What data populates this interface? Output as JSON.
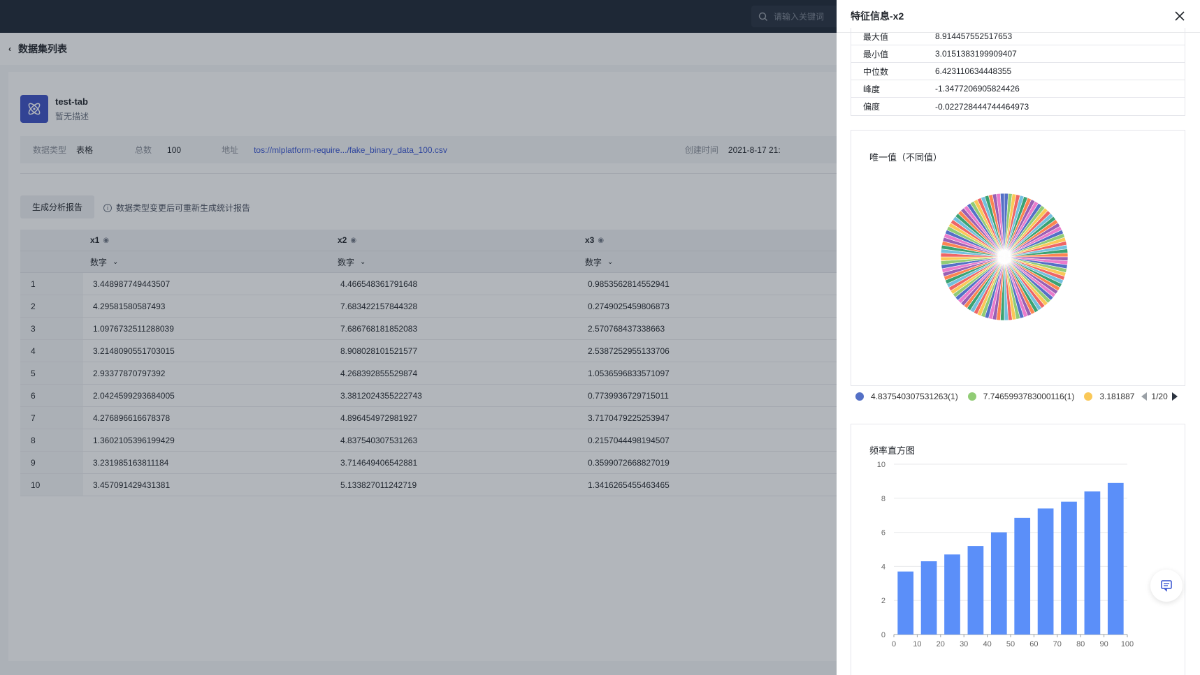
{
  "topbar": {
    "search_placeholder": "请输入关键词"
  },
  "breadcrumb": {
    "label": "数据集列表"
  },
  "dataset": {
    "name": "test-tab",
    "description": "暂无描述",
    "meta": {
      "type_label": "数据类型",
      "type_value": "表格",
      "count_label": "总数",
      "count_value": "100",
      "addr_label": "地址",
      "addr_value": "tos://mlplatform-require.../fake_binary_data_100.csv",
      "created_label": "创建时间",
      "created_value": "2021-8-17 21:"
    }
  },
  "actions": {
    "generate_report": "生成分析报告",
    "tip": "数据类型变更后可重新生成统计报告"
  },
  "table": {
    "columns": [
      {
        "name": "x1",
        "type": "数字"
      },
      {
        "name": "x2",
        "type": "数字"
      },
      {
        "name": "x3",
        "type": "数字"
      }
    ],
    "rows": [
      {
        "idx": "1",
        "c1": "3.448987749443507",
        "c2": "4.466548361791648",
        "c3": "0.9853562814552941"
      },
      {
        "idx": "2",
        "c1": "4.29581580587493",
        "c2": "7.683422157844328",
        "c3": "0.2749025459806873"
      },
      {
        "idx": "3",
        "c1": "1.0976732511288039",
        "c2": "7.686768181852083",
        "c3": "2.570768437338663"
      },
      {
        "idx": "4",
        "c1": "3.2148090551703015",
        "c2": "8.908028101521577",
        "c3": "2.5387252955133706"
      },
      {
        "idx": "5",
        "c1": "2.93377870797392",
        "c2": "4.268392855529874",
        "c3": "1.0536596833571097"
      },
      {
        "idx": "6",
        "c1": "2.04245992936840​05",
        "c2": "3.3812024355222743",
        "c3": "0.7739936729715011"
      },
      {
        "idx": "7",
        "c1": "4.276896616678378",
        "c2": "4.896454972981927",
        "c3": "3.7170479225253947"
      },
      {
        "idx": "8",
        "c1": "1.3602105396199429",
        "c2": "4.837540307531263",
        "c3": "0.2157044498194507"
      },
      {
        "idx": "9",
        "c1": "3.231985163811184",
        "c2": "3.714649406542881",
        "c3": "0.3599072668827019"
      },
      {
        "idx": "10",
        "c1": "3.457091429431381",
        "c2": "5.133827011242719",
        "c3": "1.3416265455463465"
      }
    ]
  },
  "drawer": {
    "title": "特征信息-x2",
    "stats": [
      {
        "k": "最大值",
        "v": "8.914457552517653"
      },
      {
        "k": "最小值",
        "v": "3.0151383199909407"
      },
      {
        "k": "中位数",
        "v": "6.423110634448355"
      },
      {
        "k": "峰度",
        "v": "-1.3477206905824426"
      },
      {
        "k": "偏度",
        "v": "-0.022728444744464973"
      }
    ],
    "pie_title": "唯一值（不同值）",
    "hist_title": "频率直方图",
    "legend": [
      {
        "label": "4.837540307531263(1)",
        "color": "#5470c6"
      },
      {
        "label": "7.7465993783000116(1)",
        "color": "#91cc75"
      },
      {
        "label": "3.181887",
        "color": "#fac858"
      }
    ],
    "pager": "1/20"
  },
  "chart_data": [
    {
      "type": "pie",
      "title": "唯一值（不同值）",
      "slice_count": 100,
      "values_note": "each unique value has count 1",
      "palette": [
        "#5470c6",
        "#91cc75",
        "#fac858",
        "#ee6666",
        "#73c0de",
        "#3ba272",
        "#fc8452",
        "#9a60b4",
        "#ea7ccc"
      ]
    },
    {
      "type": "bar",
      "title": "频率直方图",
      "categories": [
        "0-10",
        "10-20",
        "20-30",
        "30-40",
        "40-50",
        "50-60",
        "60-70",
        "70-80",
        "80-90",
        "90-100"
      ],
      "x_ticks": [
        "0",
        "10",
        "20",
        "30",
        "40",
        "50",
        "60",
        "70",
        "80",
        "90",
        "100"
      ],
      "values": [
        3.7,
        4.3,
        4.7,
        5.2,
        6.0,
        6.85,
        7.4,
        7.8,
        8.4,
        8.9
      ],
      "ylim": [
        0,
        10
      ],
      "y_ticks": [
        "0",
        "2",
        "4",
        "6",
        "8",
        "10"
      ],
      "color": "#5b8ff9"
    }
  ]
}
